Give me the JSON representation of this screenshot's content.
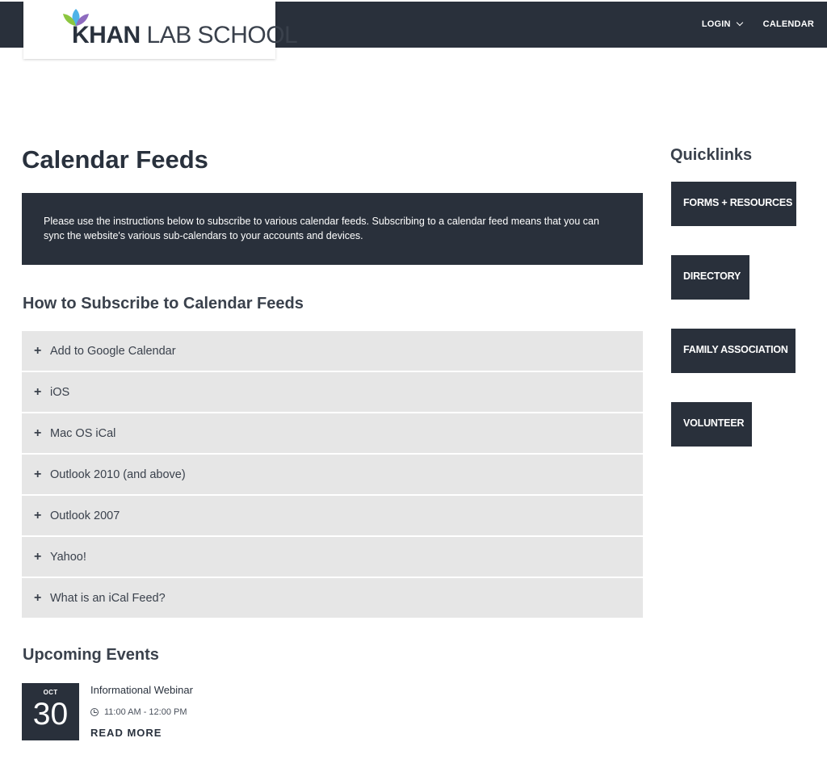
{
  "header": {
    "logo_bold": "KHAN",
    "logo_light": " LAB SCHOOL",
    "nav": {
      "login": "LOGIN",
      "calendar": "CALENDAR"
    }
  },
  "main": {
    "title": "Calendar Feeds",
    "intro": "Please use the instructions below to subscribe to various calendar feeds. Subscribing to a calendar feed means that you can sync the website's various sub-calendars to your accounts and devices.",
    "subscribe_heading": "How to Subscribe to Calendar Feeds",
    "accordion": [
      {
        "label": "Add to Google Calendar"
      },
      {
        "label": "iOS"
      },
      {
        "label": "Mac OS iCal"
      },
      {
        "label": "Outlook 2010 (and above)"
      },
      {
        "label": "Outlook 2007"
      },
      {
        "label": "Yahoo!"
      },
      {
        "label": "What is an iCal Feed?"
      }
    ],
    "events_heading": "Upcoming Events",
    "event": {
      "month": "OCT",
      "day": "30",
      "title": "Informational Webinar",
      "time": "11:00 AM - 12:00 PM",
      "read_more": "READ MORE"
    }
  },
  "sidebar": {
    "title": "Quicklinks",
    "links": [
      {
        "label": "FORMS + RESOURCES"
      },
      {
        "label": "DIRECTORY"
      },
      {
        "label": "FAMILY ASSOCIATION"
      },
      {
        "label": "VOLUNTEER"
      }
    ]
  },
  "icons": {
    "logo": "lotus-flower-icon",
    "accordion": "plus-icon",
    "dropdown": "chevron-down-icon",
    "time": "clock-icon"
  },
  "colors": {
    "navy": "#29303b",
    "accordion_bg": "#e6e6e6",
    "logo_leaf_green": "#8cc63f",
    "logo_leaf_blue": "#4fb3e8",
    "logo_leaf_purple": "#8e6bbf"
  }
}
